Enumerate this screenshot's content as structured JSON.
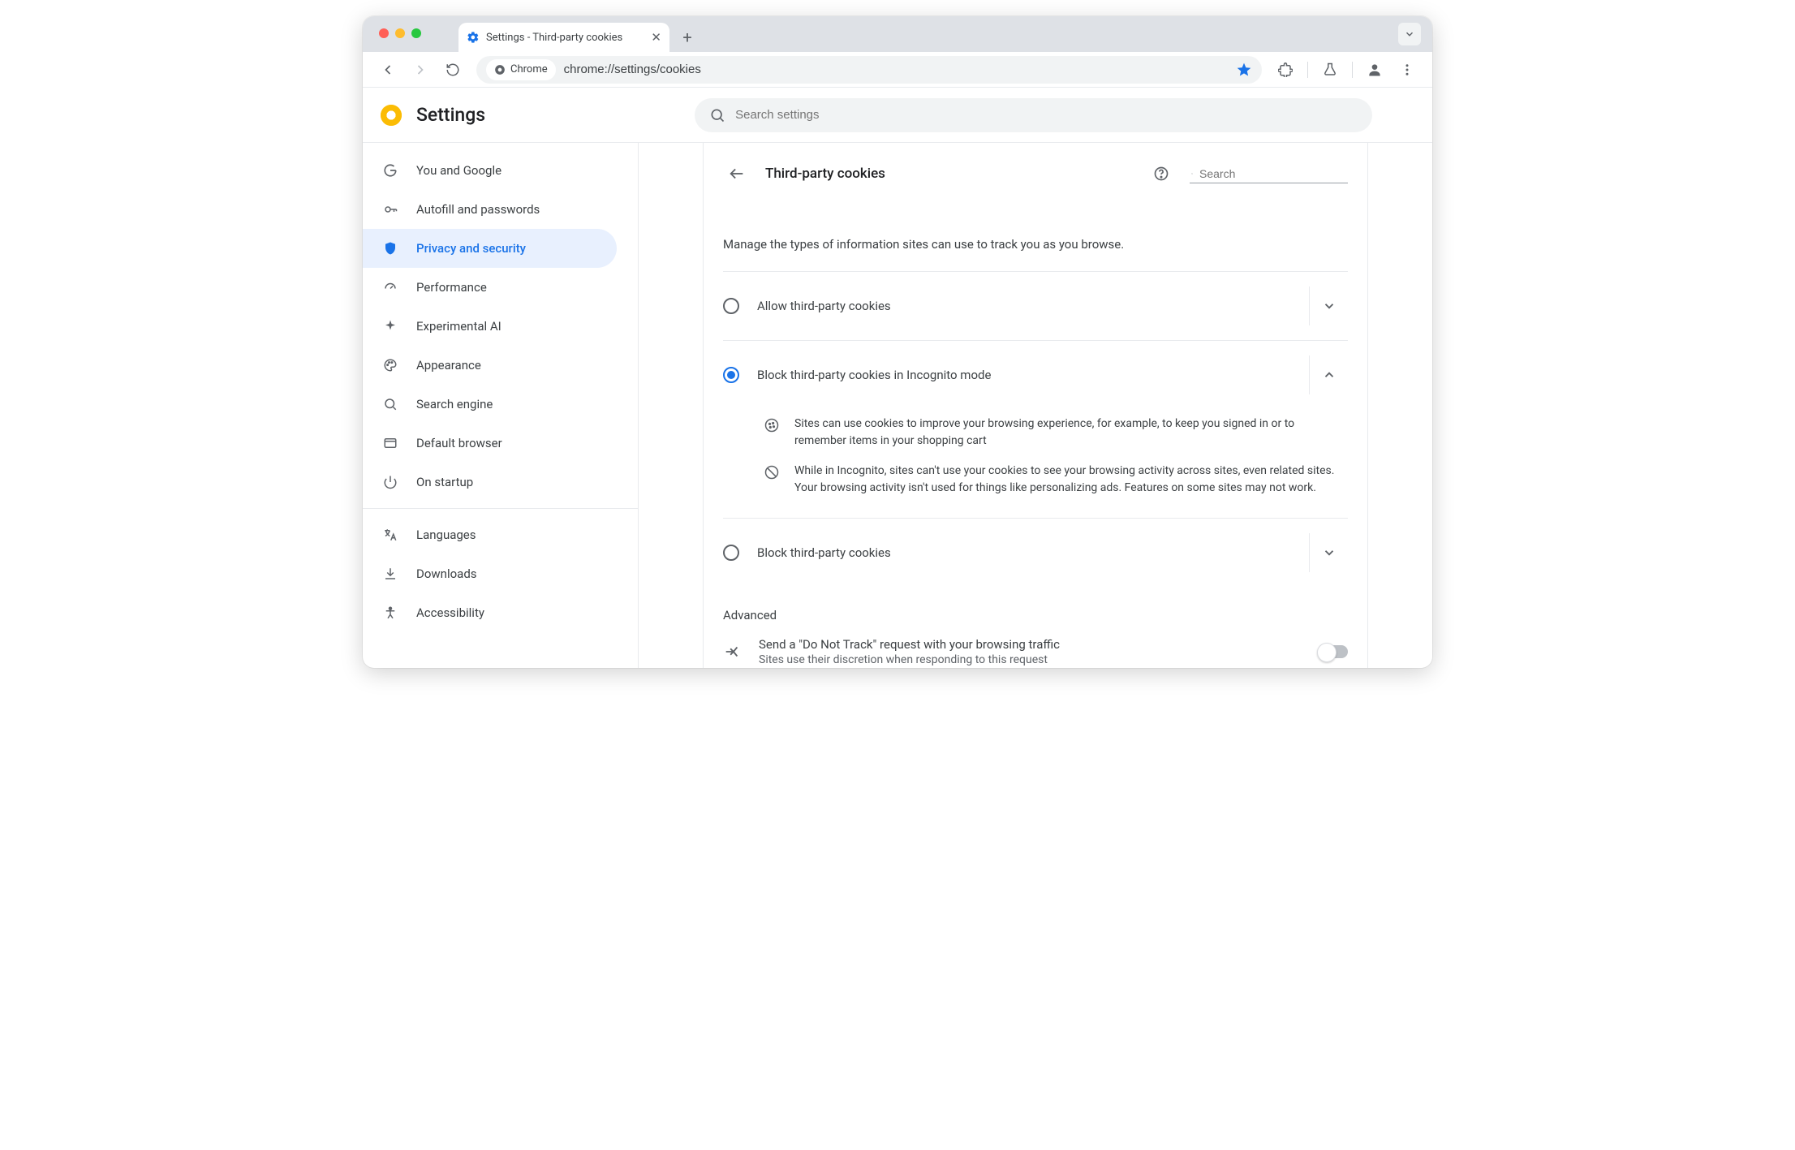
{
  "tab": {
    "title": "Settings - Third-party cookies"
  },
  "addr": {
    "chip": "Chrome",
    "url": "chrome://settings/cookies"
  },
  "header": {
    "title": "Settings",
    "search_placeholder": "Search settings"
  },
  "sidebar": {
    "items": [
      {
        "label": "You and Google"
      },
      {
        "label": "Autofill and passwords"
      },
      {
        "label": "Privacy and security"
      },
      {
        "label": "Performance"
      },
      {
        "label": "Experimental AI"
      },
      {
        "label": "Appearance"
      },
      {
        "label": "Search engine"
      },
      {
        "label": "Default browser"
      },
      {
        "label": "On startup"
      }
    ],
    "items2": [
      {
        "label": "Languages"
      },
      {
        "label": "Downloads"
      },
      {
        "label": "Accessibility"
      }
    ]
  },
  "page": {
    "title": "Third-party cookies",
    "search_placeholder": "Search",
    "desc": "Manage the types of information sites can use to track you as you browse.",
    "options": [
      {
        "label": "Allow third-party cookies"
      },
      {
        "label": "Block third-party cookies in Incognito mode"
      },
      {
        "label": "Block third-party cookies"
      }
    ],
    "details": [
      "Sites can use cookies to improve your browsing experience, for example, to keep you signed in or to remember items in your shopping cart",
      "While in Incognito, sites can't use your cookies to see your browsing activity across sites, even related sites. Your browsing activity isn't used for things like personalizing ads. Features on some sites may not work."
    ],
    "advanced_label": "Advanced",
    "dnt": {
      "title": "Send a \"Do Not Track\" request with your browsing traffic",
      "sub": "Sites use their discretion when responding to this request"
    }
  }
}
